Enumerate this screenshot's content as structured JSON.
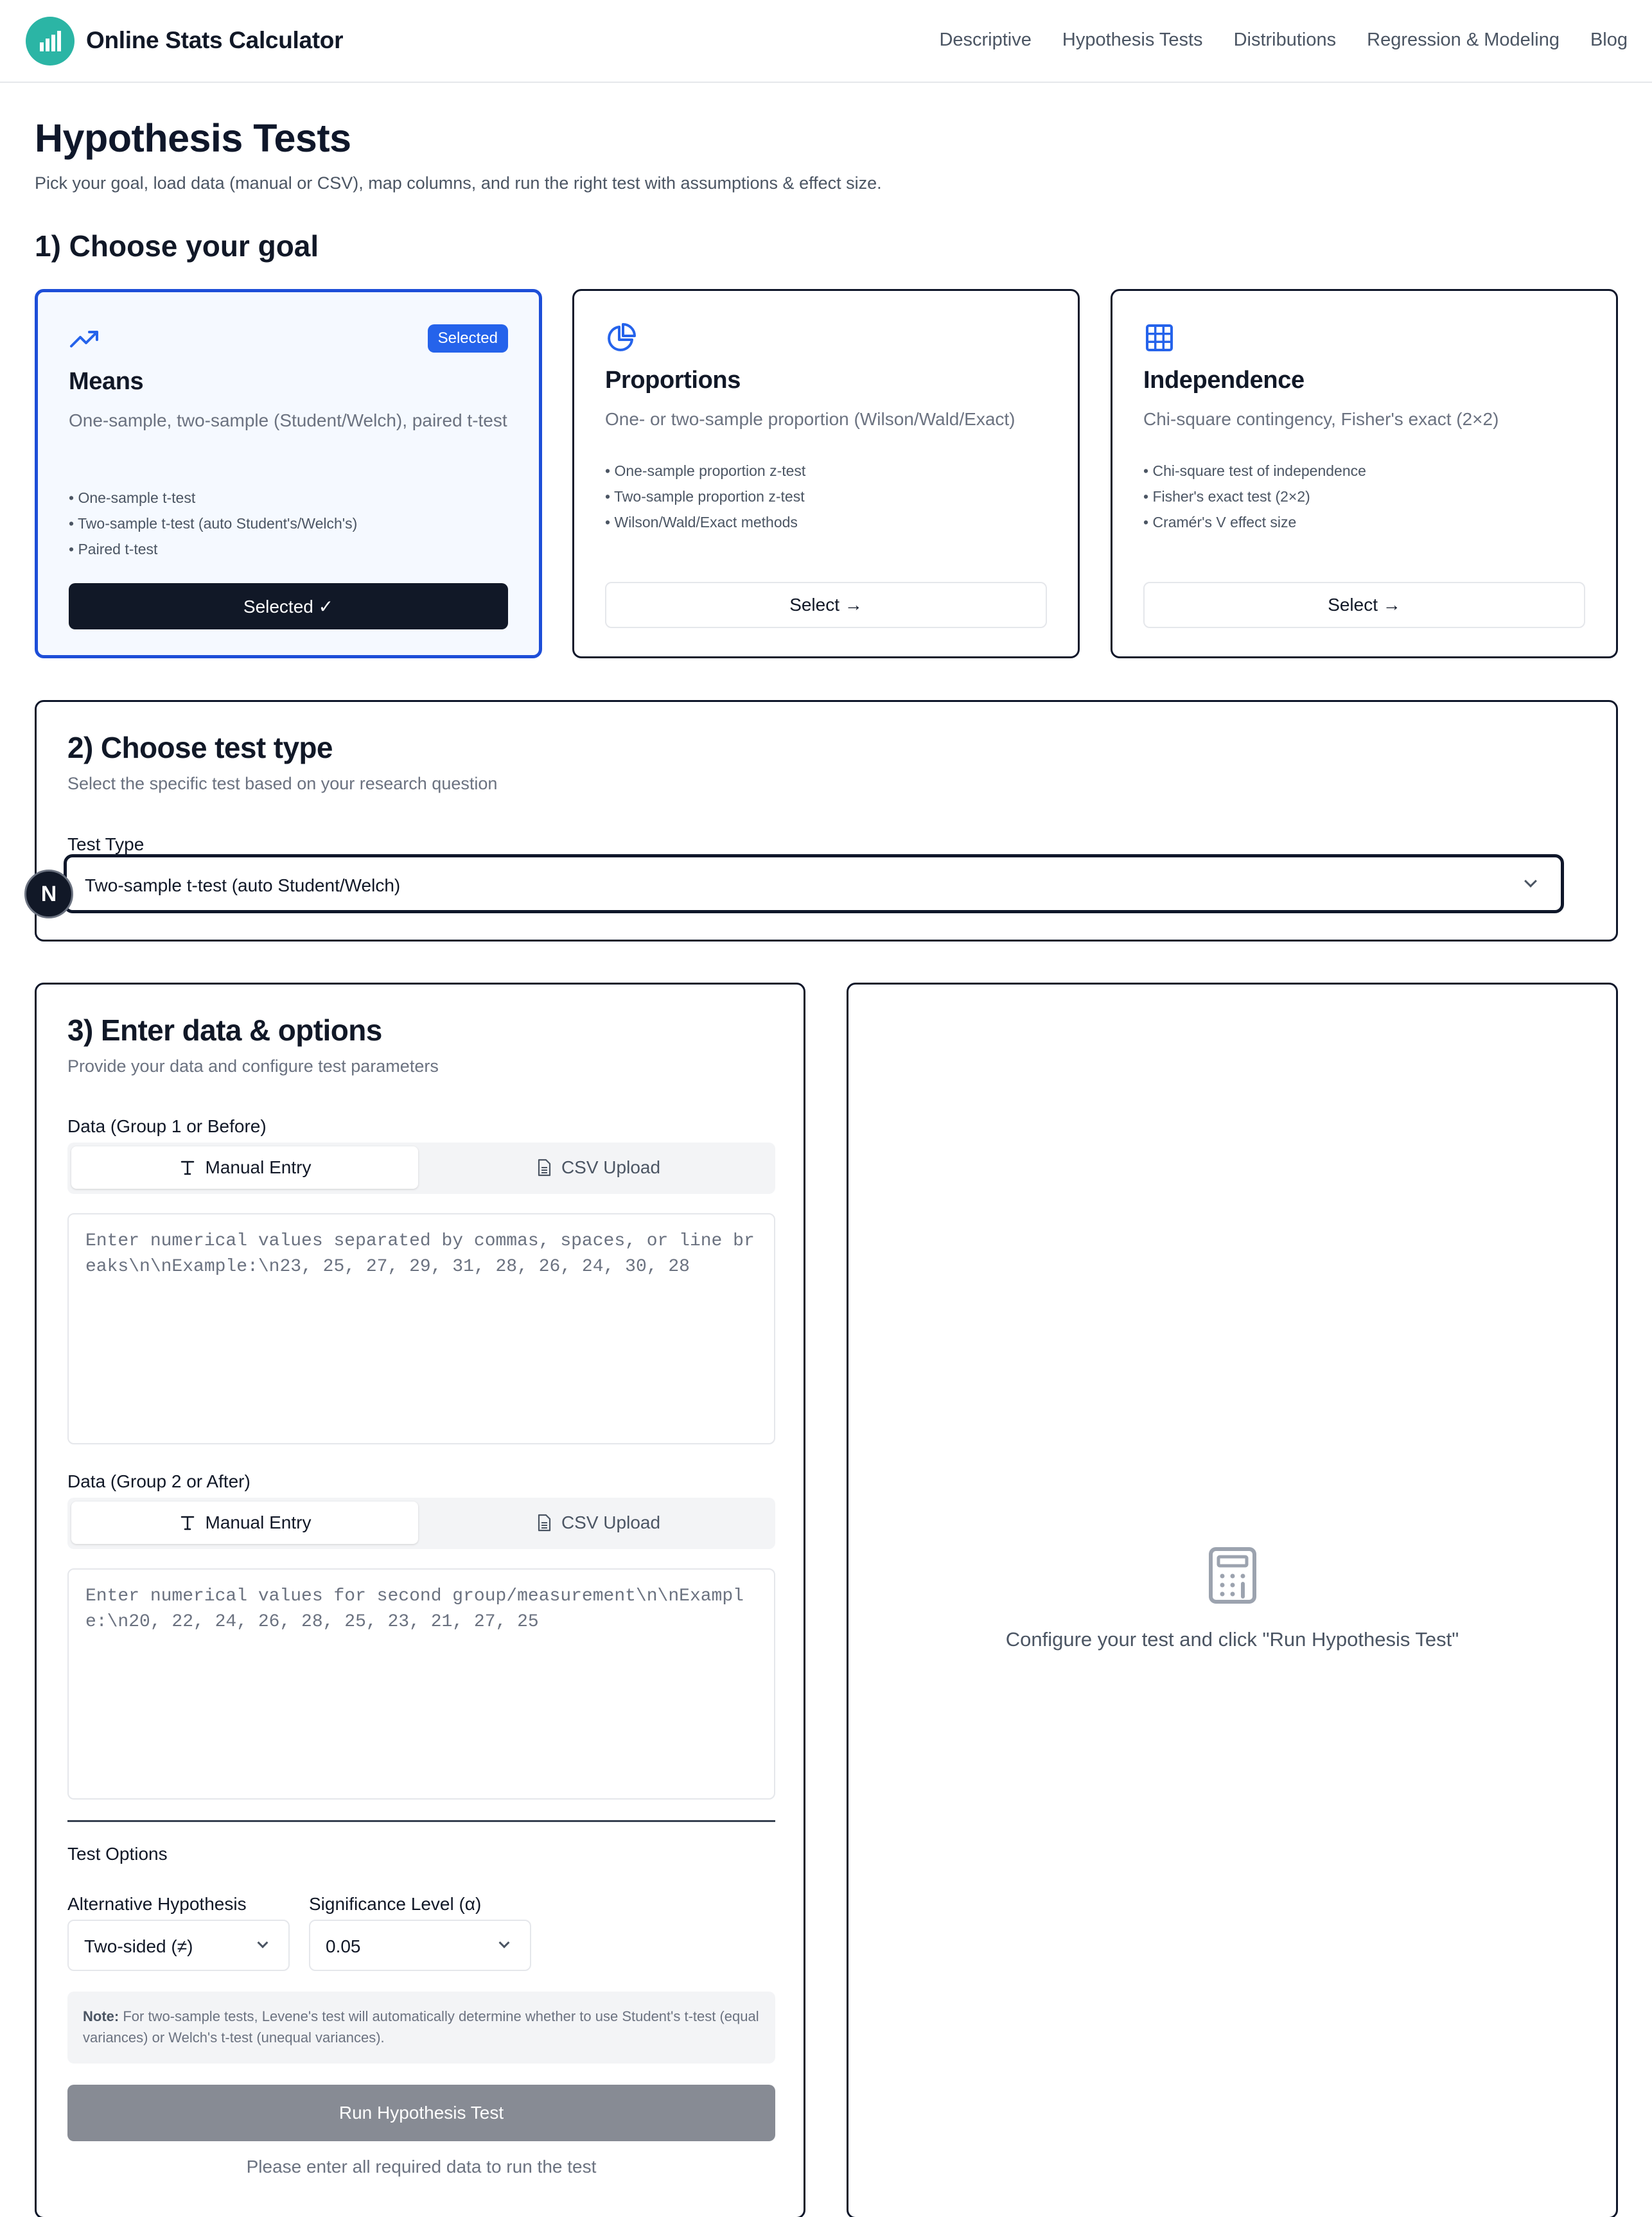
{
  "header": {
    "brand": "Online Stats Calculator",
    "nav": [
      "Descriptive",
      "Hypothesis Tests",
      "Distributions",
      "Regression & Modeling",
      "Blog"
    ],
    "logo_color": "#2bb5a5"
  },
  "page": {
    "title": "Hypothesis Tests",
    "subtitle": "Pick your goal, load data (manual or CSV), map columns, and run the right test with assumptions & effect size."
  },
  "goal": {
    "heading": "1) Choose your goal",
    "cards": [
      {
        "icon": "trending-up-icon",
        "badge": "Selected",
        "title": "Means",
        "desc": "One-sample, two-sample (Student/Welch), paired t-test",
        "items": [
          "One-sample t-test",
          "Two-sample t-test (auto Student's/Welch's)",
          "Paired t-test"
        ],
        "button": "Selected ✓"
      },
      {
        "icon": "pie-chart-icon",
        "title": "Proportions",
        "desc": "One- or two-sample proportion (Wilson/Wald/Exact)",
        "items": [
          "One-sample proportion z-test",
          "Two-sample proportion z-test",
          "Wilson/Wald/Exact methods"
        ],
        "button": "Select →"
      },
      {
        "icon": "grid-icon",
        "title": "Independence",
        "desc": "Chi-square contingency, Fisher's exact (2×2)",
        "items": [
          "Chi-square test of independence",
          "Fisher's exact test (2×2)",
          "Cramér's V effect size"
        ],
        "button": "Select →"
      }
    ]
  },
  "test_type": {
    "heading": "2) Choose test type",
    "subtitle": "Select the specific test based on your research question",
    "label": "Test Type",
    "value": "Two-sample t-test (auto Student/Welch)"
  },
  "data_entry": {
    "heading": "3) Enter data & options",
    "subtitle": "Provide your data and configure test parameters",
    "group1": {
      "label": "Data (Group 1 or Before)",
      "tab_manual": "Manual Entry",
      "tab_csv": "CSV Upload",
      "placeholder": "Enter numerical values separated by commas, spaces, or line breaks\\n\\nExample:\\n23, 25, 27, 29, 31, 28, 26, 24, 30, 28"
    },
    "group2": {
      "label": "Data (Group 2 or After)",
      "tab_manual": "Manual Entry",
      "tab_csv": "CSV Upload",
      "placeholder": "Enter numerical values for second group/measurement\\n\\nExample:\\n20, 22, 24, 26, 28, 25, 23, 21, 27, 25"
    },
    "options_heading": "Test Options",
    "alt_label": "Alternative Hypothesis",
    "alt_value": "Two-sided (≠)",
    "alpha_label": "Significance Level (α)",
    "alpha_value": "0.05",
    "note_bold": "Note:",
    "note_text": " For two-sample tests, Levene's test will automatically determine whether to use Student's t-test (equal variances) or Welch's t-test (unequal variances).",
    "run_button": "Run Hypothesis Test",
    "hint": "Please enter all required data to run the test"
  },
  "results": {
    "icon": "calculator-icon",
    "message": "Configure your test and click \"Run Hypothesis Test\""
  },
  "dev_badge": "N"
}
